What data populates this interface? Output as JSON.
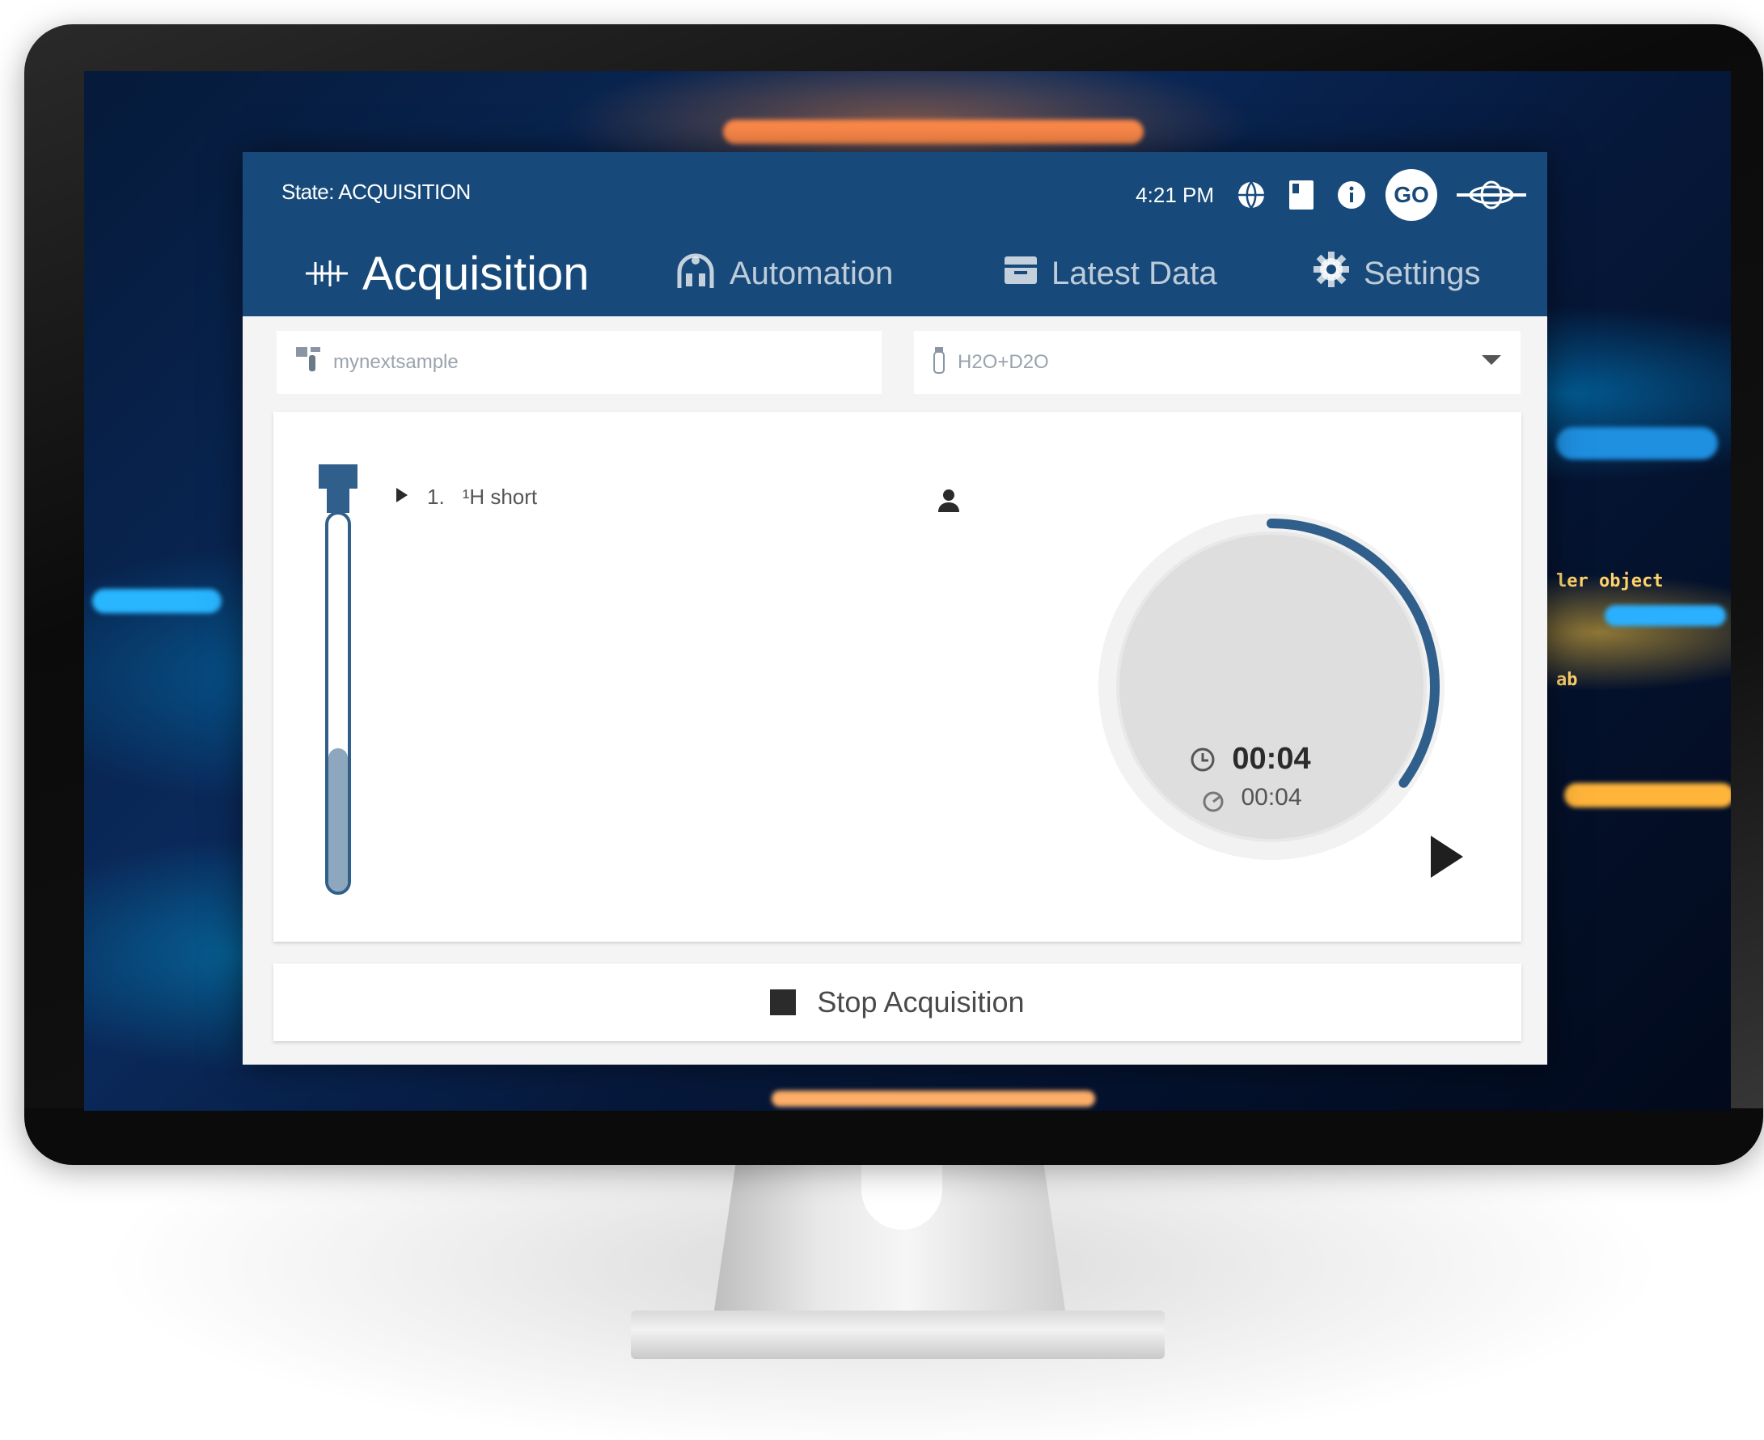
{
  "header": {
    "state": "State: ACQUISITION",
    "time": "4:21 PM",
    "user_initials": "GO",
    "icons": [
      "globe-icon",
      "notebook-icon",
      "info-icon",
      "spectrometer-icon"
    ]
  },
  "tabs": [
    {
      "label": "Acquisition",
      "icon": "acquisition-icon",
      "active": true
    },
    {
      "label": "Automation",
      "icon": "automation-icon",
      "active": false
    },
    {
      "label": "Latest Data",
      "icon": "data-icon",
      "active": false
    },
    {
      "label": "Settings",
      "icon": "gear-icon",
      "active": false
    }
  ],
  "sample": {
    "name_placeholder": "mynextsample",
    "solvent_placeholder": "H2O+D2O"
  },
  "experiments": [
    {
      "index": "1.",
      "name": "¹H short"
    }
  ],
  "timer": {
    "elapsed": "00:04",
    "total": "00:04",
    "progress": 0.35
  },
  "tube_fill": 0.38,
  "actions": {
    "stop_label": "Stop Acquisition"
  },
  "background_code": [
    "ler object",
    "ab"
  ],
  "colors": {
    "header": "#174a7a",
    "accent": "#2f5f8a"
  }
}
